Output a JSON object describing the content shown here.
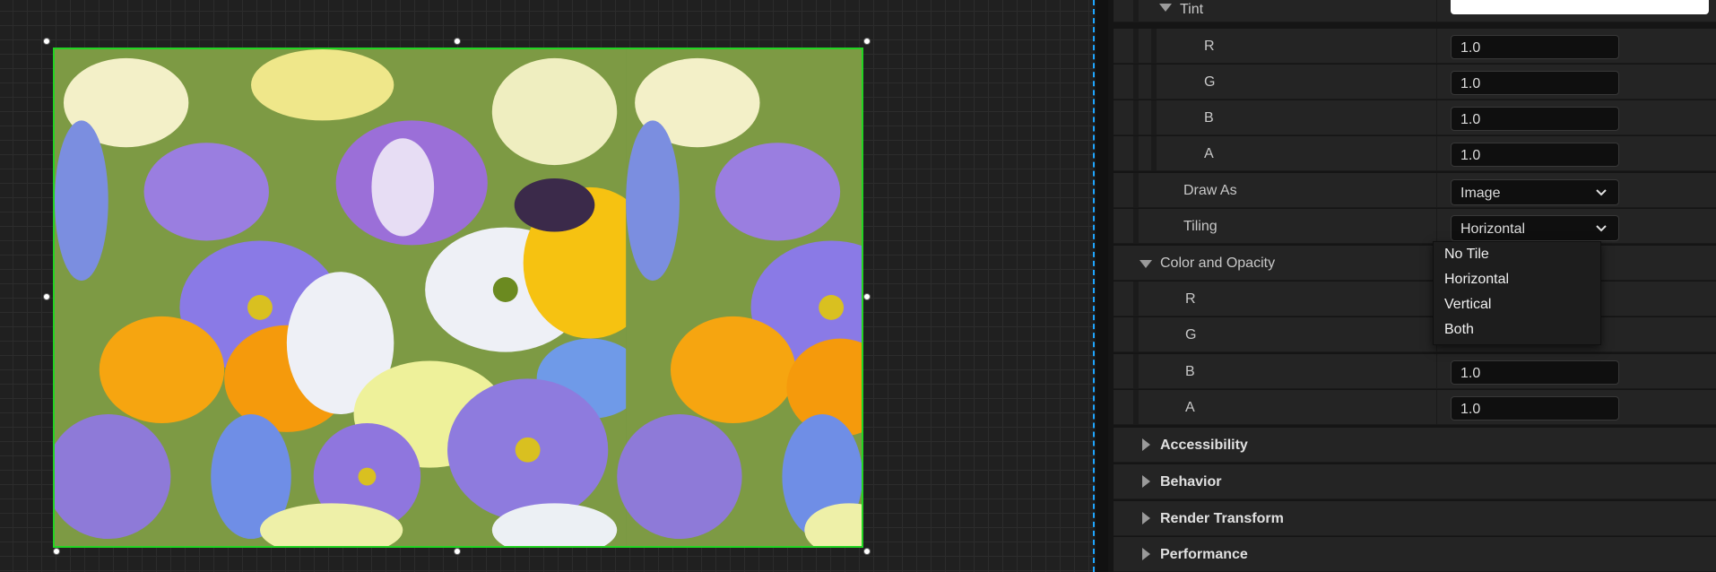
{
  "details": {
    "tint": {
      "label": "Tint",
      "channels": [
        {
          "label": "R",
          "value": "1.0"
        },
        {
          "label": "G",
          "value": "1.0"
        },
        {
          "label": "B",
          "value": "1.0"
        },
        {
          "label": "A",
          "value": "1.0"
        }
      ]
    },
    "draw_as": {
      "label": "Draw As",
      "value": "Image"
    },
    "tiling": {
      "label": "Tiling",
      "value": "Horizontal"
    },
    "tiling_menu": [
      "No Tile",
      "Horizontal",
      "Vertical",
      "Both"
    ],
    "color_and_opacity": {
      "label": "Color and Opacity",
      "channels": [
        {
          "label": "R",
          "value": ""
        },
        {
          "label": "G",
          "value": ""
        },
        {
          "label": "B",
          "value": "1.0"
        },
        {
          "label": "A",
          "value": "1.0"
        }
      ]
    },
    "sections": [
      "Accessibility",
      "Behavior",
      "Render Transform",
      "Performance"
    ]
  },
  "colors": {
    "selection_outline": "#22d422",
    "guide_line": "#1fa6ff",
    "panel_row": "#242424"
  }
}
